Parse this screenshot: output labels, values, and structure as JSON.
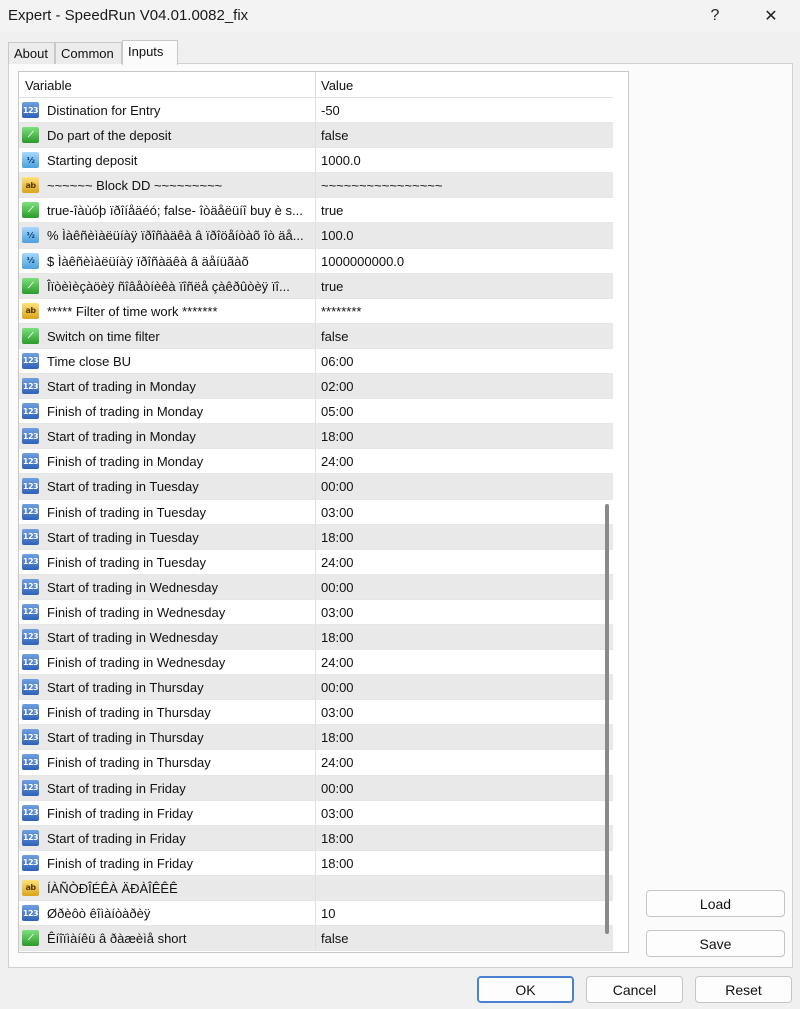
{
  "window": {
    "title": "Expert - SpeedRun V04.01.0082_fix",
    "help_label": "?",
    "close_label": "✕"
  },
  "tabs": [
    {
      "label": "About"
    },
    {
      "label": "Common"
    },
    {
      "label": "Inputs"
    }
  ],
  "grid": {
    "col_variable": "Variable",
    "col_value": "Value",
    "rows": [
      {
        "type": "int",
        "name": "Distination for Entry",
        "value": "-50"
      },
      {
        "type": "bool",
        "name": "Do part of the deposit",
        "value": "false"
      },
      {
        "type": "dbl",
        "name": "Starting deposit",
        "value": "1000.0"
      },
      {
        "type": "str",
        "name": "~~~~~~  Block DD  ~~~~~~~~~",
        "value": "~~~~~~~~~~~~~~~~"
      },
      {
        "type": "bool",
        "name": "true-îàùóþ ïðîíåäéó; false- îòäåëüíî buy è s...",
        "value": "true"
      },
      {
        "type": "dbl",
        "name": "% Ìàêñèìàëüíàÿ ïðîñàäêà â ïðîöåíòàõ îò äå...",
        "value": "100.0"
      },
      {
        "type": "dbl",
        "name": "$ Ìàêñèìàëüíàÿ ïðîñàäêà â äåíüãàõ",
        "value": "1000000000.0"
      },
      {
        "type": "bool",
        "name": "Îïòèìèçàöèÿ ñîâåòíèêà ïîñëå çàêðûòèÿ ïî...",
        "value": "true"
      },
      {
        "type": "str",
        "name": "*****    Filter of time work    *******",
        "value": "********"
      },
      {
        "type": "bool",
        "name": "Switch on time filter",
        "value": "false"
      },
      {
        "type": "int",
        "name": "Time close BU",
        "value": "06:00"
      },
      {
        "type": "int",
        "name": "Start of trading in Monday",
        "value": "02:00"
      },
      {
        "type": "int",
        "name": "Finish of trading in Monday",
        "value": "05:00"
      },
      {
        "type": "int",
        "name": "Start of trading in Monday",
        "value": "18:00"
      },
      {
        "type": "int",
        "name": "Finish of trading in Monday",
        "value": "24:00"
      },
      {
        "type": "int",
        "name": "Start of trading in Tuesday",
        "value": "00:00"
      },
      {
        "type": "int",
        "name": "Finish of trading in Tuesday",
        "value": "03:00"
      },
      {
        "type": "int",
        "name": "Start of trading in Tuesday",
        "value": "18:00"
      },
      {
        "type": "int",
        "name": "Finish of trading in Tuesday",
        "value": "24:00"
      },
      {
        "type": "int",
        "name": "Start of trading in Wednesday",
        "value": "00:00"
      },
      {
        "type": "int",
        "name": "Finish of trading in Wednesday",
        "value": "03:00"
      },
      {
        "type": "int",
        "name": "Start of trading in Wednesday",
        "value": "18:00"
      },
      {
        "type": "int",
        "name": "Finish of trading in Wednesday",
        "value": "24:00"
      },
      {
        "type": "int",
        "name": "Start of trading in Thursday",
        "value": "00:00"
      },
      {
        "type": "int",
        "name": "Finish of trading in Thursday",
        "value": "03:00"
      },
      {
        "type": "int",
        "name": "Start of trading in Thursday",
        "value": "18:00"
      },
      {
        "type": "int",
        "name": "Finish of trading in Thursday",
        "value": "24:00"
      },
      {
        "type": "int",
        "name": "Start of trading in Friday",
        "value": "00:00"
      },
      {
        "type": "int",
        "name": "Finish of trading in Friday",
        "value": "03:00"
      },
      {
        "type": "int",
        "name": "Start of trading in Friday",
        "value": "18:00"
      },
      {
        "type": "int",
        "name": "Finish of trading in Friday",
        "value": "18:00"
      },
      {
        "type": "str",
        "name": "ÍÀÑÒÐÎÉÊÀ ÄÐÀÎÊÊÊ",
        "value": ""
      },
      {
        "type": "int",
        "name": "Øðèôò êîìàíòàðèÿ",
        "value": "10"
      },
      {
        "type": "bool",
        "name": "Êíîïìàíêü â ðàæèìå short",
        "value": "false"
      }
    ]
  },
  "icon_labels": {
    "int": "123",
    "bool": "⟋",
    "dbl": "½",
    "str": "ab"
  },
  "buttons": {
    "load": "Load",
    "save": "Save",
    "ok": "OK",
    "cancel": "Cancel",
    "reset": "Reset"
  }
}
